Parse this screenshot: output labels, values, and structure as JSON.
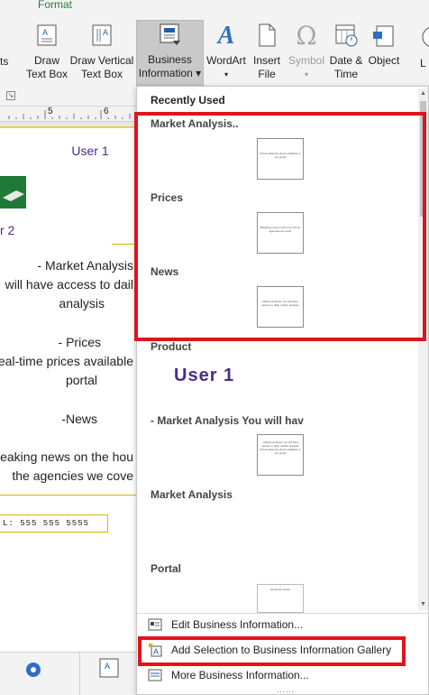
{
  "ribbon": {
    "tab_format": "Format",
    "partial_left": "ts",
    "buttons": {
      "draw_text_box": [
        "Draw",
        "Text Box"
      ],
      "draw_vertical_text_box": [
        "Draw Vertical",
        "Text Box"
      ],
      "business_information": [
        "Business",
        "Information ▾"
      ],
      "wordart": [
        "WordArt",
        "▾"
      ],
      "insert_file": [
        "Insert",
        "File"
      ],
      "symbol": [
        "Symbol",
        "▾"
      ],
      "date_time": [
        "Date &",
        "Time"
      ],
      "object": [
        "Object",
        ""
      ],
      "partial_right": "L"
    }
  },
  "document": {
    "ruler_marks": [
      "5",
      "6"
    ],
    "user1": "User 1",
    "user2": "r 2",
    "lines": [
      "- Market Analysis",
      "will have access to dail",
      "analysis",
      "- Prices",
      "eal-time prices available",
      "portal",
      "-News",
      "reaking news on the hou",
      "the agencies we cove"
    ],
    "tel": "L: 555 555 5555"
  },
  "gallery": {
    "section_title": "Recently Used",
    "items": [
      {
        "label": "Market Analysis..",
        "thumb_text": "Prices Real-the prices available in our portal"
      },
      {
        "label": "Prices",
        "thumb_text": "Breaking news on the hour all the agencies we cover"
      },
      {
        "label": "News",
        "thumb_text": "Market Analysis You will have access to daily market analysis"
      },
      {
        "label": "Product",
        "thumb_text": ""
      },
      {
        "label": "- Market Analysis  You will hav",
        "thumb_text": "- Market Analysis You will have access to daily market analysis Prices Real-the prices available in our portal"
      },
      {
        "label": "Market Analysis",
        "thumb_text": ""
      },
      {
        "label": "Portal",
        "thumb_text": "adventure works"
      }
    ],
    "product_preview": "User 1"
  },
  "menu": {
    "edit": "Edit Business Information...",
    "add_selection": "Add Selection to Business Information Gallery",
    "more": "More Business Information..."
  },
  "colors": {
    "highlight": "#e0141e",
    "accent_purple": "#4b2c8a",
    "format_tab": "#2b7a3a"
  }
}
